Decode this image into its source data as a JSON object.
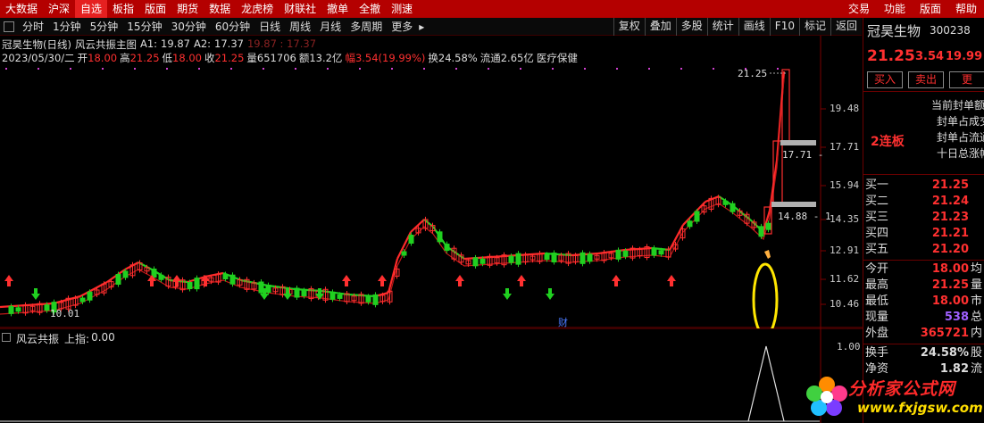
{
  "topbar": {
    "menu": [
      "大数据",
      "沪深",
      "自选",
      "板指",
      "版面",
      "期货",
      "数据",
      "龙虎榜",
      "财联社",
      "撤单",
      "全撤",
      "测速"
    ],
    "active_index": 2,
    "right": [
      "交易",
      "功能",
      "版面",
      "帮助"
    ]
  },
  "periodbar": {
    "periods": [
      "分时",
      "1分钟",
      "5分钟",
      "15分钟",
      "30分钟",
      "60分钟",
      "日线",
      "周线",
      "月线",
      "多周期",
      "更多"
    ],
    "more_arrow": "▸",
    "buttons": [
      "复权",
      "叠加",
      "多股",
      "统计",
      "画线",
      "F10",
      "标记",
      "返回"
    ]
  },
  "info": {
    "stock_title": "冠昊生物(日线)",
    "indicator": "风云共振主图",
    "a1_label": "A1:",
    "a1_value": "19.87",
    "a2_label": "A2:",
    "a2_value": "17.37",
    "dim_values": "19.87 : 17.37",
    "date": "2023/05/30/二",
    "open_label": "开",
    "open": "18.00",
    "high_label": "高",
    "high": "21.25",
    "low_label": "低",
    "low": "18.00",
    "close_label": "收",
    "close": "21.25",
    "vol_label": "量",
    "vol": "651706",
    "amount_label": "额",
    "amount": "13.2亿",
    "amp_label": "幅",
    "amp": "3.54(19.99%)",
    "turnover": "换24.58%",
    "float": "流通2.65亿",
    "sector": "医疗保健"
  },
  "price_axis": [
    "19.48",
    "17.71",
    "15.94",
    "14.35",
    "12.91",
    "11.62",
    "10.46"
  ],
  "annotations": {
    "high_mark": "21.25",
    "low_mark": "10.01",
    "level_1": "17.71 -",
    "level_2": "14.88 - 1",
    "cai_marker": "财"
  },
  "sub": {
    "title": "风云共振",
    "upper_label": "上指:",
    "upper_value": "0.00",
    "axis_top": "1.00"
  },
  "rpanel": {
    "name": "冠昊生物",
    "code": "300238",
    "price": "21.25",
    "change": "3.54",
    "pct": "19.99",
    "btn_buy": "买入",
    "btn_sell": "卖出",
    "btn_more": "更",
    "lianban": "2连板",
    "notes": [
      "当前封单额",
      "封单占成交",
      "封单占流通",
      "十日总涨幅"
    ],
    "bids": [
      {
        "label": "买一",
        "value": "21.25"
      },
      {
        "label": "买二",
        "value": "21.24"
      },
      {
        "label": "买三",
        "value": "21.23"
      },
      {
        "label": "买四",
        "value": "21.21"
      },
      {
        "label": "买五",
        "value": "21.20"
      }
    ],
    "stats": [
      {
        "label": "今开",
        "value": "18.00",
        "extra": "均"
      },
      {
        "label": "最高",
        "value": "21.25",
        "extra": "量"
      },
      {
        "label": "最低",
        "value": "18.00",
        "extra": "市"
      },
      {
        "label": "现量",
        "value": "538",
        "extra": "总"
      },
      {
        "label": "外盘",
        "value": "365721",
        "extra": "内"
      }
    ],
    "stats2": [
      {
        "label": "换手",
        "value": "24.58%",
        "extra": "股"
      },
      {
        "label": "净资",
        "value": "1.82",
        "extra": "流"
      }
    ]
  },
  "watermark": {
    "title": "分析家公式网",
    "url": "www.fxjgsw.com"
  },
  "colors": {
    "up": "#ff3030",
    "down": "#20d020",
    "accent": "#b40000",
    "highlight": "#ffe600"
  }
}
